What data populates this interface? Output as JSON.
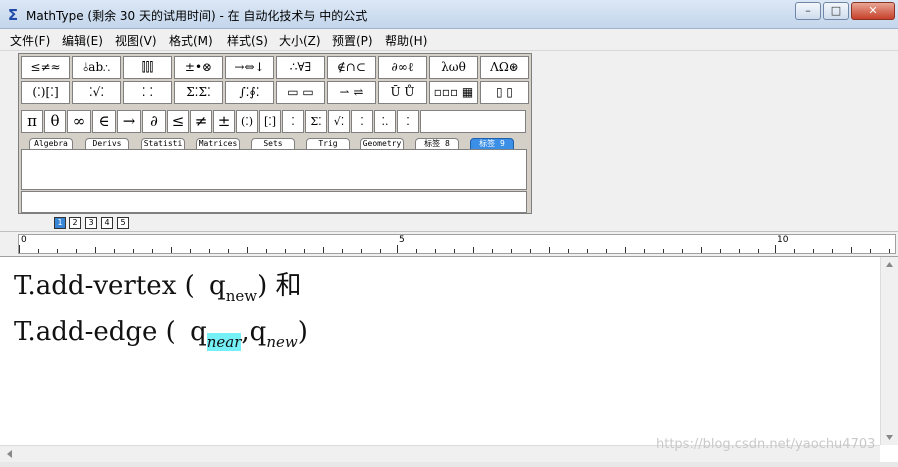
{
  "window": {
    "title": "MathType (剩余 30 天的试用时间) - 在 自动化技术与 中的公式",
    "app_icon_glyph": "Σ",
    "minimize_glyph": "–",
    "maximize_glyph": "□",
    "close_glyph": "✕"
  },
  "menu": [
    "文件(F)",
    "编辑(E)",
    "视图(V)",
    "格式(M)",
    "样式(S)",
    "大小(Z)",
    "预置(P)",
    "帮助(H)"
  ],
  "palette": {
    "row1": [
      "≤≠≈",
      "⫰ab∴",
      "⫿⫿⫿",
      "±•⊗",
      "→⇔↓",
      "∴∀∃",
      "∉∩⊂",
      "∂∞ℓ",
      "λωθ",
      "ΛΩ⊛"
    ],
    "row2": [
      "(⁚)[⁚]",
      "⁚√⁚",
      "⁚ ⁚",
      "Σ⁚Σ⁚",
      "∫⁚∮⁚",
      "▭ ▭",
      "⇀ ⇌",
      "Ū Ů",
      "▫▫▫ ▦",
      "▯ ▯"
    ],
    "symbols": [
      "π",
      "θ",
      "∞",
      "∈",
      "→",
      "∂",
      "≤",
      "≠",
      "±",
      "(⁚)",
      "[⁚]",
      "⁚",
      "Σ⁚",
      "√⁚",
      "⁚",
      "⁚.",
      "⁚"
    ],
    "tabs": [
      "Algebra",
      "Derivs",
      "Statisti",
      "Matrices",
      "Sets",
      "Trig",
      "Geometry",
      "标签 8",
      "标签 9"
    ]
  },
  "sizebar": [
    "1",
    "2",
    "3",
    "4",
    "5"
  ],
  "ruler": {
    "marks": [
      "0",
      "5",
      "10"
    ]
  },
  "equation": {
    "line1": {
      "prefix": "T.add-vertex (",
      "var": "q",
      "sub": "new",
      "suffix": ") 和"
    },
    "line2": {
      "prefix": "T.add-edge (",
      "var1": "q",
      "sub1": "near",
      "comma": ",",
      "var2": "q",
      "sub2": "new",
      "suffix": ")"
    }
  },
  "watermark": "https://blog.csdn.net/yaochu4703",
  "colors": {
    "selection": "#74f0f6",
    "active_tab": "#3b8fe6"
  }
}
